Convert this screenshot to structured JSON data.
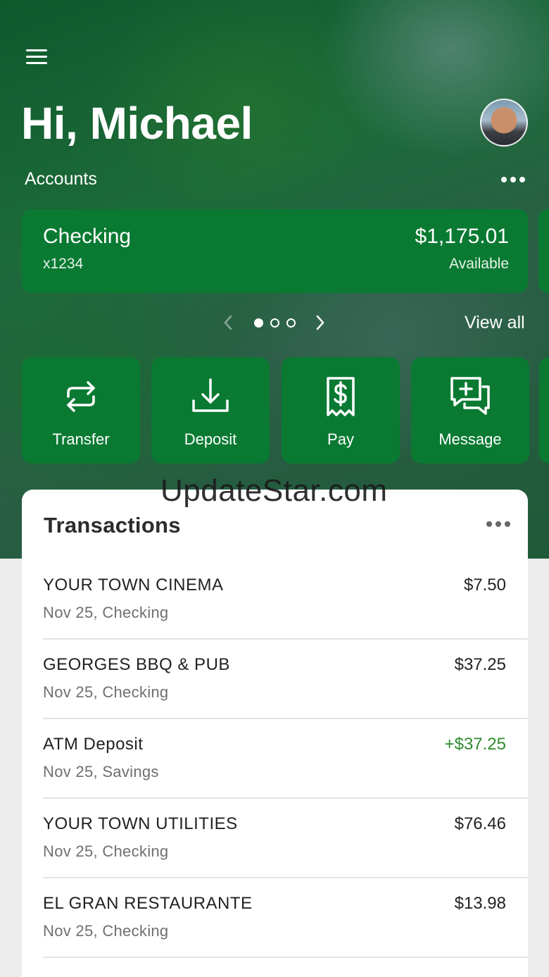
{
  "header": {
    "greeting": "Hi, Michael"
  },
  "accounts": {
    "label": "Accounts",
    "card": {
      "name": "Checking",
      "number": "x1234",
      "balance": "$1,175.01",
      "balance_label": "Available"
    },
    "pager": {
      "pages": 3,
      "active_page": 1
    },
    "view_all": "View all"
  },
  "actions": [
    {
      "label": "Transfer",
      "icon": "transfer-arrows-icon"
    },
    {
      "label": "Deposit",
      "icon": "deposit-download-icon"
    },
    {
      "label": "Pay",
      "icon": "pay-receipt-icon"
    },
    {
      "label": "Message",
      "icon": "message-chat-icon"
    }
  ],
  "watermark": "UpdateStar.com",
  "transactions": {
    "title": "Transactions",
    "items": [
      {
        "merchant": "YOUR TOWN CINEMA",
        "meta": "Nov 25, Checking",
        "amount": "$7.50",
        "credit": false
      },
      {
        "merchant": "GEORGES BBQ & PUB",
        "meta": "Nov 25, Checking",
        "amount": "$37.25",
        "credit": false
      },
      {
        "merchant": "ATM Deposit",
        "meta": "Nov 25, Savings",
        "amount": "+$37.25",
        "credit": true
      },
      {
        "merchant": "YOUR TOWN UTILITIES",
        "meta": "Nov 25, Checking",
        "amount": "$76.46",
        "credit": false
      },
      {
        "merchant": "EL GRAN RESTAURANTE",
        "meta": "Nov 25, Checking",
        "amount": "$13.98",
        "credit": false
      }
    ]
  },
  "colors": {
    "brand_green": "#0a7a32",
    "credit_green": "#2e8b2e"
  }
}
